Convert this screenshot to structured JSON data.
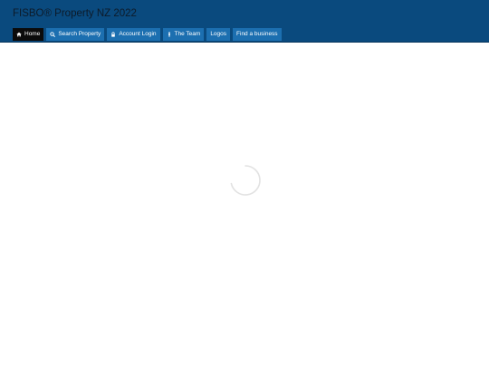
{
  "header": {
    "title": "FISBO® Property NZ 2022",
    "background_color": "#0a4a7e"
  },
  "nav": {
    "items": [
      {
        "label": "Home",
        "icon": "home-icon",
        "active": true
      },
      {
        "label": "Search Property",
        "icon": "search-icon",
        "active": false
      },
      {
        "label": "Account Login",
        "icon": "lock-icon",
        "active": false
      },
      {
        "label": "The Team",
        "icon": "person-icon",
        "active": false
      },
      {
        "label": "Logos",
        "icon": "",
        "active": false
      },
      {
        "label": "Find a business",
        "icon": "",
        "active": false
      }
    ],
    "item_color": "#1c6fb0",
    "active_color": "#0b0b0b"
  },
  "main": {
    "loading_spinner_icon": "loading-spinner-icon"
  }
}
